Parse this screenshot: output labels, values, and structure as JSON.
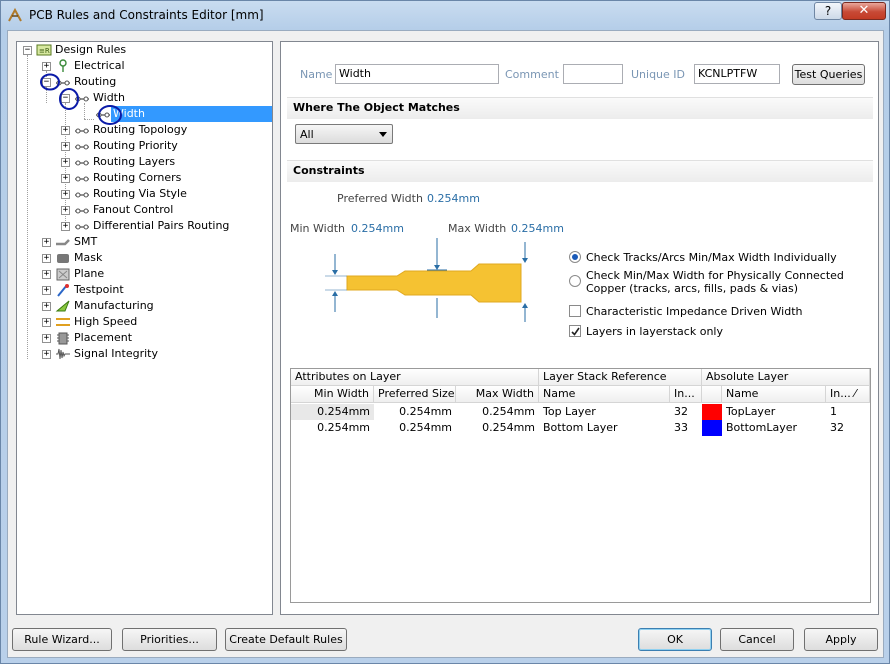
{
  "window": {
    "title": "PCB Rules and Constraints Editor [mm]",
    "help_label": "?",
    "close_label": "✕"
  },
  "tree": {
    "root": "Design Rules",
    "electrical": "Electrical",
    "routing": "Routing",
    "width_group": "Width",
    "width_rule": "Width",
    "routing_topology": "Routing Topology",
    "routing_priority": "Routing Priority",
    "routing_layers": "Routing Layers",
    "routing_corners": "Routing Corners",
    "routing_via_style": "Routing Via Style",
    "fanout_control": "Fanout Control",
    "differential_pairs": "Differential Pairs Routing",
    "smt": "SMT",
    "mask": "Mask",
    "plane": "Plane",
    "testpoint": "Testpoint",
    "manufacturing": "Manufacturing",
    "high_speed": "High Speed",
    "placement": "Placement",
    "signal_integrity": "Signal Integrity"
  },
  "rule": {
    "name_label": "Name",
    "name_value": "Width",
    "comment_label": "Comment",
    "comment_value": "",
    "uid_label": "Unique ID",
    "uid_value": "KCNLPTFW",
    "test_queries_label": "Test Queries"
  },
  "where": {
    "title": "Where The Object Matches",
    "selected": "All"
  },
  "constraints": {
    "title": "Constraints",
    "preferred_width_label": "Preferred Width",
    "preferred_width_value": "0.254mm",
    "min_width_label": "Min Width",
    "min_width_value": "0.254mm",
    "max_width_label": "Max Width",
    "max_width_value": "0.254mm",
    "opt_individually": "Check Tracks/Arcs Min/Max Width Individually",
    "opt_connected_1": "Check Min/Max Width for Physically Connected",
    "opt_connected_2": "Copper (tracks, arcs, fills, pads & vias)",
    "opt_impedance": "Characteristic Impedance Driven Width",
    "opt_layerstack": "Layers in layerstack only",
    "selected_option": "individually",
    "impedance_checked": false,
    "layerstack_checked": true
  },
  "grid": {
    "group_attributes": "Attributes on Layer",
    "group_layerstack": "Layer Stack Reference",
    "group_absolute": "Absolute Layer",
    "col_min": "Min Width",
    "col_pref": "Preferred Size",
    "col_max": "Max Width",
    "col_name": "Name",
    "col_index": "In...",
    "col_abs_name": "Name",
    "col_abs_index": "In... ⁄",
    "rows": [
      {
        "min": "0.254mm",
        "pref": "0.254mm",
        "max": "0.254mm",
        "name": "Top Layer",
        "index": "32",
        "color": "#ff0000",
        "abs_name": "TopLayer",
        "abs_index": "1"
      },
      {
        "min": "0.254mm",
        "pref": "0.254mm",
        "max": "0.254mm",
        "name": "Bottom Layer",
        "index": "33",
        "color": "#0000ff",
        "abs_name": "BottomLayer",
        "abs_index": "32"
      }
    ]
  },
  "footer": {
    "rule_wizard": "Rule Wizard...",
    "priorities": "Priorities...",
    "create_default": "Create Default Rules",
    "ok": "OK",
    "cancel": "Cancel",
    "apply": "Apply"
  },
  "colors": {
    "selection": "#3399ff",
    "track": "#f5c232",
    "annotation_circle": "#0a1aa8"
  }
}
